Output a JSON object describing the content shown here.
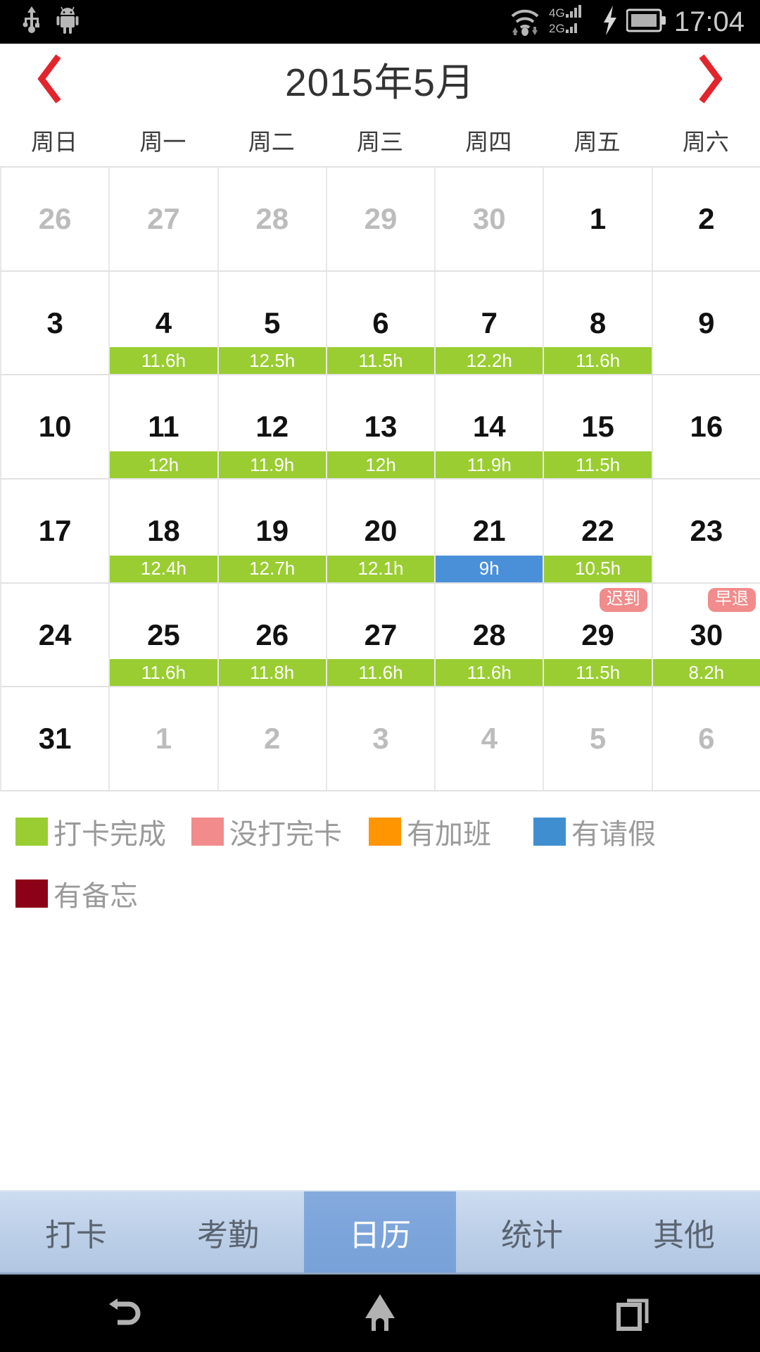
{
  "statusbar": {
    "time": "17:04",
    "icons": [
      "usb-icon",
      "android-robot-icon",
      "wifi-icon",
      "signal-4g-icon",
      "signal-2g-icon",
      "charging-bolt-icon",
      "battery-icon"
    ],
    "net_4g_label": "4G",
    "net_2g_label": "2G"
  },
  "header": {
    "prev_label": "‹",
    "next_label": "›",
    "title": "2015年5月",
    "accent_color": "#e2242c"
  },
  "weekdays": [
    "周日",
    "周一",
    "周二",
    "周三",
    "周四",
    "周五",
    "周六"
  ],
  "calendar": {
    "rows": [
      [
        {
          "day": "26",
          "other": true
        },
        {
          "day": "27",
          "other": true
        },
        {
          "day": "28",
          "other": true
        },
        {
          "day": "29",
          "other": true
        },
        {
          "day": "30",
          "other": true
        },
        {
          "day": "1",
          "other": false
        },
        {
          "day": "2",
          "other": false
        }
      ],
      [
        {
          "day": "3",
          "other": false
        },
        {
          "day": "4",
          "other": false,
          "hours": "11.6h",
          "bar": "green"
        },
        {
          "day": "5",
          "other": false,
          "hours": "12.5h",
          "bar": "green"
        },
        {
          "day": "6",
          "other": false,
          "hours": "11.5h",
          "bar": "green"
        },
        {
          "day": "7",
          "other": false,
          "hours": "12.2h",
          "bar": "green"
        },
        {
          "day": "8",
          "other": false,
          "hours": "11.6h",
          "bar": "green"
        },
        {
          "day": "9",
          "other": false
        }
      ],
      [
        {
          "day": "10",
          "other": false
        },
        {
          "day": "11",
          "other": false,
          "hours": "12h",
          "bar": "green"
        },
        {
          "day": "12",
          "other": false,
          "hours": "11.9h",
          "bar": "green"
        },
        {
          "day": "13",
          "other": false,
          "hours": "12h",
          "bar": "green"
        },
        {
          "day": "14",
          "other": false,
          "hours": "11.9h",
          "bar": "green"
        },
        {
          "day": "15",
          "other": false,
          "hours": "11.5h",
          "bar": "green"
        },
        {
          "day": "16",
          "other": false
        }
      ],
      [
        {
          "day": "17",
          "other": false
        },
        {
          "day": "18",
          "other": false,
          "hours": "12.4h",
          "bar": "green"
        },
        {
          "day": "19",
          "other": false,
          "hours": "12.7h",
          "bar": "green"
        },
        {
          "day": "20",
          "other": false,
          "hours": "12.1h",
          "bar": "green"
        },
        {
          "day": "21",
          "other": false,
          "hours": "9h",
          "bar": "blue"
        },
        {
          "day": "22",
          "other": false,
          "hours": "10.5h",
          "bar": "green"
        },
        {
          "day": "23",
          "other": false
        }
      ],
      [
        {
          "day": "24",
          "other": false
        },
        {
          "day": "25",
          "other": false,
          "hours": "11.6h",
          "bar": "green"
        },
        {
          "day": "26",
          "other": false,
          "hours": "11.8h",
          "bar": "green"
        },
        {
          "day": "27",
          "other": false,
          "hours": "11.6h",
          "bar": "green"
        },
        {
          "day": "28",
          "other": false,
          "hours": "11.6h",
          "bar": "green"
        },
        {
          "day": "29",
          "other": false,
          "hours": "11.5h",
          "bar": "green",
          "badge": "迟到"
        },
        {
          "day": "30",
          "other": false,
          "hours": "8.2h",
          "bar": "green",
          "badge": "早退"
        }
      ],
      [
        {
          "day": "31",
          "other": false
        },
        {
          "day": "1",
          "other": true
        },
        {
          "day": "2",
          "other": true
        },
        {
          "day": "3",
          "other": true
        },
        {
          "day": "4",
          "other": true
        },
        {
          "day": "5",
          "other": true
        },
        {
          "day": "6",
          "other": true
        }
      ]
    ]
  },
  "legend": {
    "row1": [
      {
        "label": "打卡完成",
        "color": "#9acd32"
      },
      {
        "label": "没打完卡",
        "color": "#f28b8b"
      },
      {
        "label": "有加班",
        "color": "#ff9500"
      },
      {
        "label": "有请假",
        "color": "#3f8fd0"
      }
    ],
    "row2": [
      {
        "label": "有备忘",
        "color": "#8c0018"
      }
    ]
  },
  "tabs": [
    {
      "label": "打卡",
      "active": false
    },
    {
      "label": "考勤",
      "active": false
    },
    {
      "label": "日历",
      "active": true
    },
    {
      "label": "统计",
      "active": false
    },
    {
      "label": "其他",
      "active": false
    }
  ],
  "navbar": {
    "back": "back-icon",
    "home": "home-icon",
    "recents": "recents-icon"
  }
}
